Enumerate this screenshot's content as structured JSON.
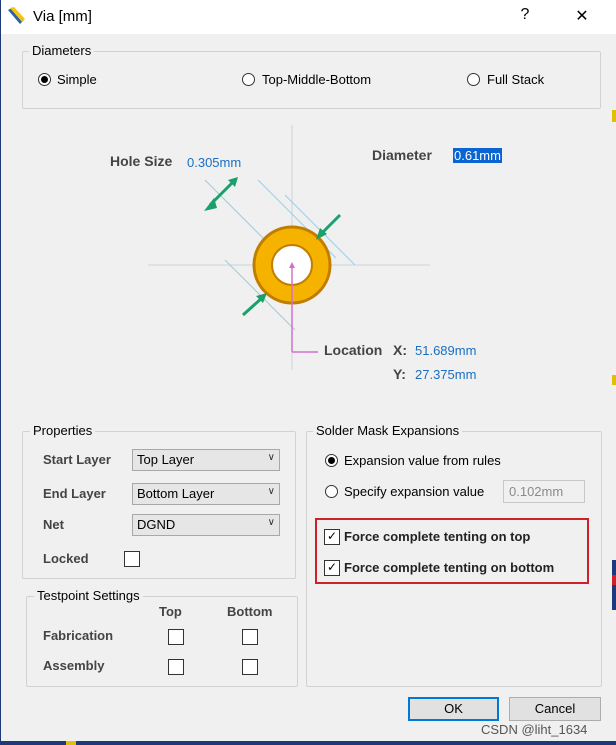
{
  "window": {
    "title": "Via [mm]",
    "help": "?",
    "close": "✕"
  },
  "diameters": {
    "group_label": "Diameters",
    "options": [
      "Simple",
      "Top-Middle-Bottom",
      "Full Stack"
    ],
    "selected": "Simple"
  },
  "diagram": {
    "hole_size_label": "Hole Size",
    "hole_size_value": "0.305mm",
    "diameter_label": "Diameter",
    "diameter_value": "0.61mm",
    "location_label": "Location",
    "x_label": "X:",
    "x_value": "51.689mm",
    "y_label": "Y:",
    "y_value": "27.375mm",
    "pad_color": "#f5b300",
    "pad_outline": "#c07d00",
    "arrow_color": "#1aa06a"
  },
  "properties": {
    "group_label": "Properties",
    "start_layer_label": "Start Layer",
    "start_layer_value": "Top Layer",
    "end_layer_label": "End Layer",
    "end_layer_value": "Bottom Layer",
    "net_label": "Net",
    "net_value": "DGND",
    "locked_label": "Locked"
  },
  "testpoint": {
    "group_label": "Testpoint Settings",
    "col_top": "Top",
    "col_bottom": "Bottom",
    "row_fabrication": "Fabrication",
    "row_assembly": "Assembly"
  },
  "solder_mask": {
    "group_label": "Solder Mask Expansions",
    "opt_rules": "Expansion value from rules",
    "opt_specify": "Specify expansion value",
    "specify_value": "0.102mm",
    "tent_top": "Force complete tenting on top",
    "tent_bottom": "Force complete tenting on bottom",
    "highlight_color": "#d0202a"
  },
  "buttons": {
    "ok": "OK",
    "cancel": "Cancel"
  },
  "watermark": "CSDN @liht_1634"
}
